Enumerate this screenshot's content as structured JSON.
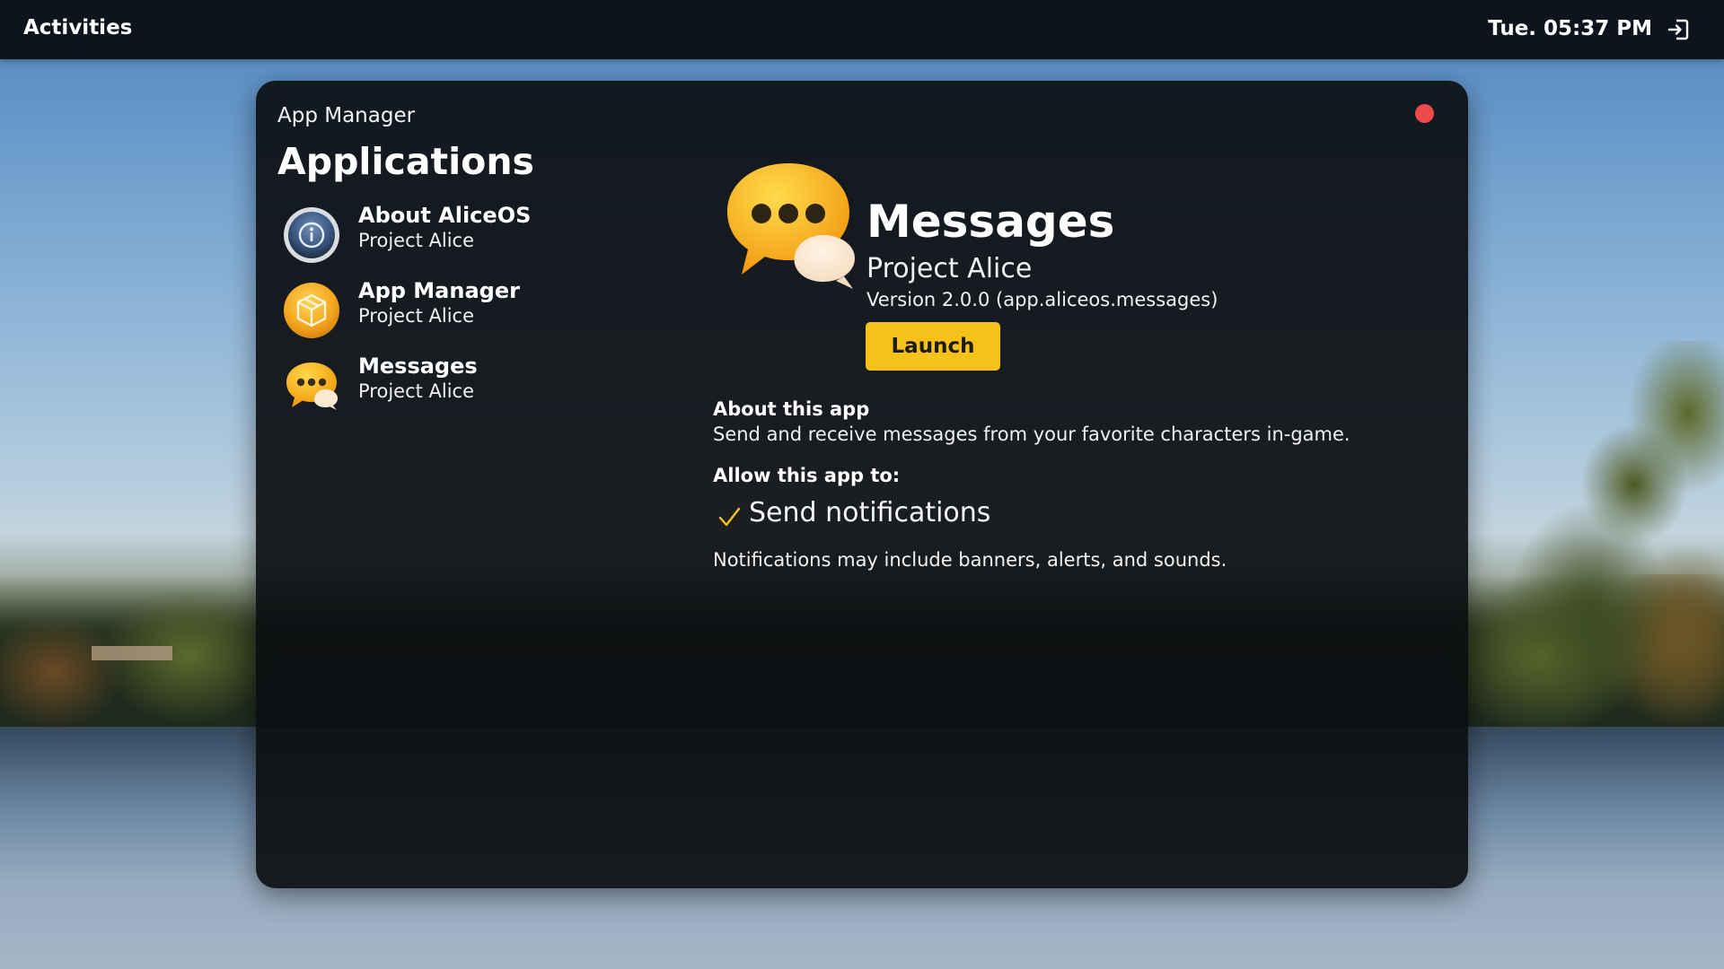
{
  "topbar": {
    "activities_label": "Activities",
    "clock": "Tue. 05:37 PM",
    "logout_icon": "logout-icon"
  },
  "window": {
    "title": "App Manager",
    "close_color": "#ee4a4d",
    "heading": "Applications",
    "apps": [
      {
        "name": "About AliceOS",
        "developer": "Project Alice",
        "icon": "info-icon"
      },
      {
        "name": "App Manager",
        "developer": "Project Alice",
        "icon": "package-icon"
      },
      {
        "name": "Messages",
        "developer": "Project Alice",
        "icon": "messages-icon"
      }
    ],
    "detail": {
      "name": "Messages",
      "developer": "Project Alice",
      "version": "Version 2.0.0 (app.aliceos.messages)",
      "launch_label": "Launch",
      "launch_color": "#f6c21a",
      "about_heading": "About this app",
      "about_text": "Send and receive messages from your favorite characters in-game.",
      "allow_heading": "Allow this app to:",
      "permissions": [
        {
          "label": "Send notifications",
          "checked": true
        }
      ],
      "permission_note": "Notifications may include banners, alerts, and sounds."
    }
  }
}
